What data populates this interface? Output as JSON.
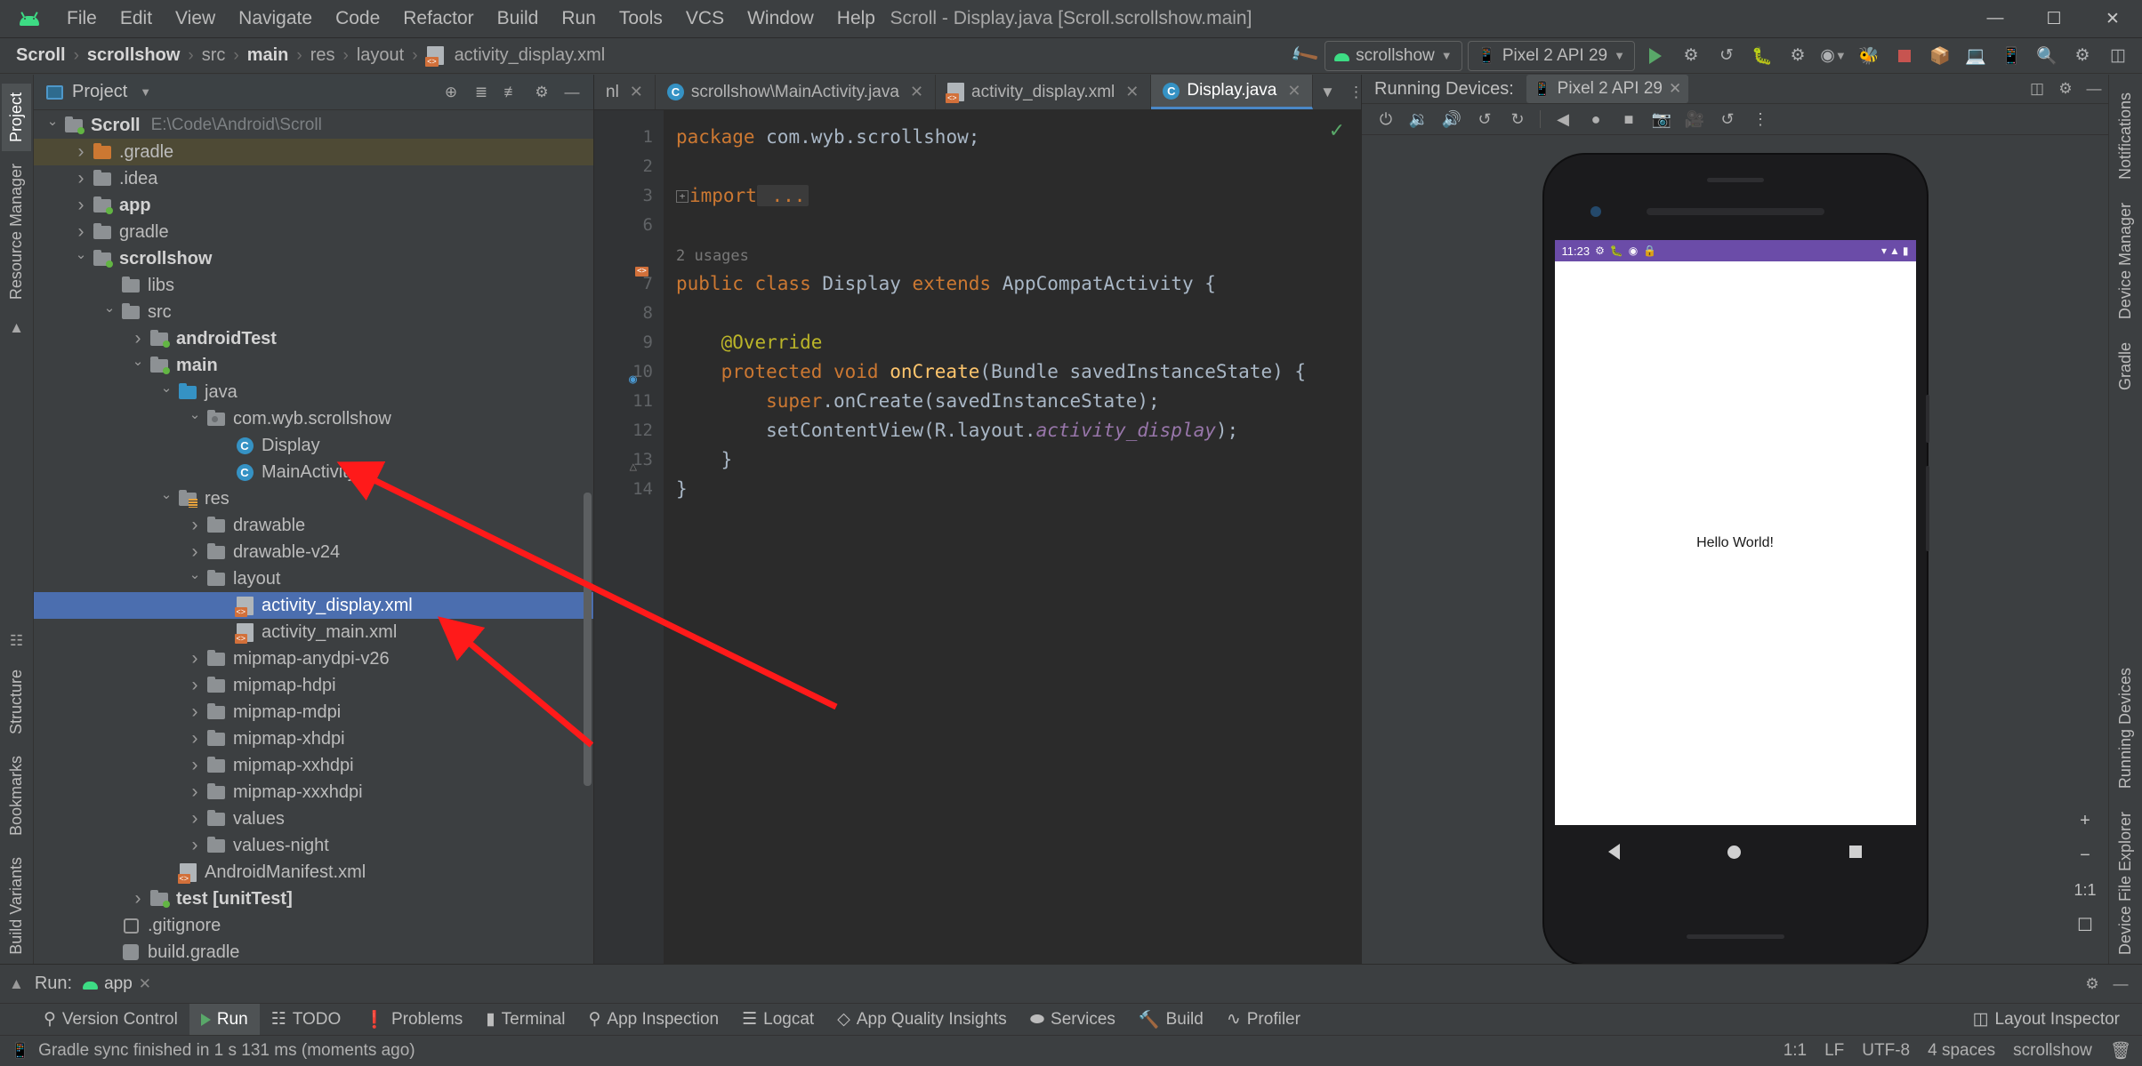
{
  "window": {
    "title": "Scroll - Display.java [Scroll.scrollshow.main]",
    "minimize": "—",
    "maximize": "☐",
    "close": "✕"
  },
  "menubar": {
    "items": [
      {
        "label": "File"
      },
      {
        "label": "Edit"
      },
      {
        "label": "View"
      },
      {
        "label": "Navigate"
      },
      {
        "label": "Code"
      },
      {
        "label": "Refactor"
      },
      {
        "label": "Build"
      },
      {
        "label": "Run"
      },
      {
        "label": "Tools"
      },
      {
        "label": "VCS"
      },
      {
        "label": "Window"
      },
      {
        "label": "Help"
      }
    ]
  },
  "breadcrumb": {
    "items": [
      "Scroll",
      "scrollshow",
      "src",
      "main",
      "res",
      "layout",
      "activity_display.xml"
    ],
    "separator": "›"
  },
  "toolbar": {
    "build_hammer": "hammer-icon",
    "module_selector": "scrollshow",
    "device_selector": "Pixel 2 API 29",
    "run_label": "run-button",
    "debug_label": "debug-button",
    "stop_label": "stop-button",
    "search_label": "search-everywhere",
    "settings_label": "settings-button"
  },
  "project_panel": {
    "title": "Project",
    "tree": [
      {
        "indent": 0,
        "arrow": "down",
        "icon": "folder-module",
        "label": "Scroll",
        "bold": true,
        "path": "E:\\Code\\Android\\Scroll"
      },
      {
        "indent": 1,
        "arrow": "right",
        "icon": "folder-orange",
        "label": ".gradle",
        "highlight": true
      },
      {
        "indent": 1,
        "arrow": "right",
        "icon": "folder",
        "label": ".idea"
      },
      {
        "indent": 1,
        "arrow": "right",
        "icon": "folder-module",
        "label": "app",
        "bold": true
      },
      {
        "indent": 1,
        "arrow": "right",
        "icon": "folder",
        "label": "gradle"
      },
      {
        "indent": 1,
        "arrow": "down",
        "icon": "folder-module",
        "label": "scrollshow",
        "bold": true
      },
      {
        "indent": 2,
        "arrow": "none",
        "icon": "folder",
        "label": "libs"
      },
      {
        "indent": 2,
        "arrow": "down",
        "icon": "folder",
        "label": "src"
      },
      {
        "indent": 3,
        "arrow": "right",
        "icon": "folder-module",
        "label": "androidTest",
        "bold": true
      },
      {
        "indent": 3,
        "arrow": "down",
        "icon": "folder-module",
        "label": "main",
        "bold": true
      },
      {
        "indent": 4,
        "arrow": "down",
        "icon": "folder-blue",
        "label": "java"
      },
      {
        "indent": 5,
        "arrow": "down",
        "icon": "folder-package",
        "label": "com.wyb.scrollshow"
      },
      {
        "indent": 6,
        "arrow": "none",
        "icon": "class",
        "label": "Display"
      },
      {
        "indent": 6,
        "arrow": "none",
        "icon": "class",
        "label": "MainActivity"
      },
      {
        "indent": 4,
        "arrow": "down",
        "icon": "folder-res",
        "label": "res"
      },
      {
        "indent": 5,
        "arrow": "right",
        "icon": "folder",
        "label": "drawable"
      },
      {
        "indent": 5,
        "arrow": "right",
        "icon": "folder",
        "label": "drawable-v24"
      },
      {
        "indent": 5,
        "arrow": "down",
        "icon": "folder",
        "label": "layout"
      },
      {
        "indent": 6,
        "arrow": "none",
        "icon": "xml",
        "label": "activity_display.xml",
        "selected": true
      },
      {
        "indent": 6,
        "arrow": "none",
        "icon": "xml",
        "label": "activity_main.xml"
      },
      {
        "indent": 5,
        "arrow": "right",
        "icon": "folder",
        "label": "mipmap-anydpi-v26"
      },
      {
        "indent": 5,
        "arrow": "right",
        "icon": "folder",
        "label": "mipmap-hdpi"
      },
      {
        "indent": 5,
        "arrow": "right",
        "icon": "folder",
        "label": "mipmap-mdpi"
      },
      {
        "indent": 5,
        "arrow": "right",
        "icon": "folder",
        "label": "mipmap-xhdpi"
      },
      {
        "indent": 5,
        "arrow": "right",
        "icon": "folder",
        "label": "mipmap-xxhdpi"
      },
      {
        "indent": 5,
        "arrow": "right",
        "icon": "folder",
        "label": "mipmap-xxxhdpi"
      },
      {
        "indent": 5,
        "arrow": "right",
        "icon": "folder",
        "label": "values"
      },
      {
        "indent": 5,
        "arrow": "right",
        "icon": "folder",
        "label": "values-night"
      },
      {
        "indent": 4,
        "arrow": "none",
        "icon": "xml",
        "label": "AndroidManifest.xml"
      },
      {
        "indent": 3,
        "arrow": "right",
        "icon": "folder-module",
        "label": "test [unitTest]",
        "bold": true
      },
      {
        "indent": 2,
        "arrow": "none",
        "icon": "git",
        "label": ".gitignore"
      },
      {
        "indent": 2,
        "arrow": "none",
        "icon": "gradle",
        "label": "build.gradle"
      }
    ]
  },
  "left_strip": {
    "tabs": [
      "Project",
      "Resource Manager"
    ],
    "bottom_tabs": [
      "Structure",
      "Bookmarks",
      "Build Variants"
    ]
  },
  "right_strip": {
    "tabs": [
      "Notifications",
      "Device Manager",
      "Gradle",
      "Running Devices",
      "Device File Explorer"
    ]
  },
  "editor": {
    "tabs": [
      {
        "label": "nl",
        "icon": "xml-icon",
        "active": false,
        "truncated": true
      },
      {
        "label": "scrollshow\\MainActivity.java",
        "icon": "class-icon",
        "active": false
      },
      {
        "label": "activity_display.xml",
        "icon": "xml-icon",
        "active": false
      },
      {
        "label": "Display.java",
        "icon": "class-icon",
        "active": true
      }
    ],
    "filename": "Display.java",
    "inspection_status": "ok",
    "lines": [
      {
        "num": "1",
        "tokens": [
          {
            "t": "package",
            "c": "kw"
          },
          {
            "t": " com.wyb.scrollshow;",
            "c": "plain"
          }
        ]
      },
      {
        "num": "2",
        "tokens": []
      },
      {
        "num": "3",
        "tokens": [
          {
            "t": "import",
            "c": "kw"
          },
          {
            "t": " ...",
            "c": "fold"
          }
        ],
        "fold": true
      },
      {
        "num": "6",
        "tokens": []
      },
      {
        "num": "",
        "tokens": [
          {
            "t": "2 usages",
            "c": "usage"
          }
        ]
      },
      {
        "num": "7",
        "tokens": [
          {
            "t": "public class ",
            "c": "kw"
          },
          {
            "t": "Display",
            "c": "typ"
          },
          {
            "t": " extends ",
            "c": "kw"
          },
          {
            "t": "AppCompatActivity {",
            "c": "plain"
          }
        ],
        "gutter_icon": "xml-layout-icon"
      },
      {
        "num": "8",
        "tokens": []
      },
      {
        "num": "9",
        "tokens": [
          {
            "t": "    @Override",
            "c": "ann"
          }
        ]
      },
      {
        "num": "10",
        "tokens": [
          {
            "t": "    protected void ",
            "c": "kw"
          },
          {
            "t": "onCreate",
            "c": "fn"
          },
          {
            "t": "(Bundle savedInstanceState) {",
            "c": "plain"
          }
        ],
        "gutter_icon": "override-icon"
      },
      {
        "num": "11",
        "tokens": [
          {
            "t": "        super",
            "c": "kw"
          },
          {
            "t": ".onCreate(savedInstanceState);",
            "c": "plain"
          }
        ]
      },
      {
        "num": "12",
        "tokens": [
          {
            "t": "        setContentView(R.layout.",
            "c": "plain"
          },
          {
            "t": "activity_display",
            "c": "fld"
          },
          {
            "t": ");",
            "c": "plain"
          }
        ]
      },
      {
        "num": "13",
        "tokens": [
          {
            "t": "    }",
            "c": "plain"
          }
        ],
        "gutter_icon": "brace-icon"
      },
      {
        "num": "14",
        "tokens": [
          {
            "t": "}",
            "c": "plain"
          }
        ]
      }
    ]
  },
  "devices": {
    "header_title": "Running Devices:",
    "tab_label": "Pixel 2 API 29",
    "tab_close": "✕",
    "toolbar_icons": [
      "power-icon",
      "volume-up-icon",
      "volume-down-icon",
      "rotate-left-icon",
      "rotate-right-icon",
      "back-icon",
      "home-icon",
      "overview-icon",
      "screenshot-icon",
      "record-icon",
      "history-icon",
      "more-icon"
    ],
    "emulator": {
      "status_time": "11:23",
      "status_icons": [
        "gear-icon",
        "bug-icon",
        "sync-icon",
        "lock-icon"
      ],
      "status_right": [
        "wifi-icon",
        "signal-icon",
        "battery-icon"
      ],
      "app_text": "Hello World!",
      "nav_buttons": [
        "back",
        "home",
        "recents"
      ]
    },
    "zoom_controls": {
      "zoom_in": "+",
      "zoom_out": "−",
      "actual_size": "1:1",
      "fit_screen": "☐"
    }
  },
  "run_window": {
    "title": "Run:",
    "tab": "app",
    "tab_close": "✕"
  },
  "bottom_toolbar": {
    "buttons": [
      {
        "label": "Version Control",
        "icon": "branch-icon",
        "active": false
      },
      {
        "label": "Run",
        "icon": "run-icon",
        "active": true
      },
      {
        "label": "TODO",
        "icon": "todo-icon",
        "active": false
      },
      {
        "label": "Problems",
        "icon": "problems-icon",
        "active": false
      },
      {
        "label": "Terminal",
        "icon": "terminal-icon",
        "active": false
      },
      {
        "label": "App Inspection",
        "icon": "inspection-icon",
        "active": false
      },
      {
        "label": "Logcat",
        "icon": "logcat-icon",
        "active": false
      },
      {
        "label": "App Quality Insights",
        "icon": "insights-icon",
        "active": false
      },
      {
        "label": "Services",
        "icon": "services-icon",
        "active": false
      },
      {
        "label": "Build",
        "icon": "build-icon",
        "active": false
      },
      {
        "label": "Profiler",
        "icon": "profiler-icon",
        "active": false
      }
    ],
    "right_label": "Layout Inspector"
  },
  "statusbar": {
    "message": "Gradle sync finished in 1 s 131 ms (moments ago)",
    "caret": "1:1",
    "line_sep": "LF",
    "encoding": "UTF-8",
    "indent": "4 spaces",
    "branch": "scrollshow"
  },
  "colors": {
    "accent_blue": "#4b6eaf",
    "android_green": "#3ddc84",
    "selection": "#4b6eaf",
    "orange_keyword": "#cc7832",
    "annotation_red": "#ff0000",
    "emulator_purple": "#6b4ca8"
  }
}
